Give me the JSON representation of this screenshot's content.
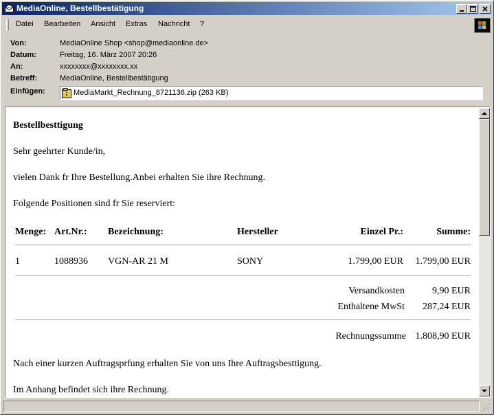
{
  "window": {
    "title": "MediaOnline, Bestellbestätigung",
    "icon": "envelope-icon"
  },
  "menu": [
    "Datei",
    "Bearbeiten",
    "Ansicht",
    "Extras",
    "Nachricht",
    "?"
  ],
  "headers": {
    "from_label": "Von:",
    "from_value": "MediaOnline Shop <shop@mediaonline.de>",
    "date_label": "Datum:",
    "date_value": "Freitag, 16. März 2007 20:26",
    "to_label": "An:",
    "to_value": "xxxxxxxx@xxxxxxxx.xx",
    "subject_label": "Betreff:",
    "subject_value": "MediaOnline, Bestellbestätigung",
    "attach_label": "Einfügen:",
    "attach_value": "MediaMarkt_Rechnung_8721136.zip (263 KB)"
  },
  "body": {
    "heading": "Bestellbesttigung",
    "greeting": "Sehr geehrter Kunde/in,",
    "intro": "vielen Dank fr Ihre Bestellung.Anbei erhalten Sie ihre Rechnung.",
    "positions_intro": "Folgende Positionen sind fr Sie reserviert:",
    "table": {
      "headers": [
        "Menge:",
        "Art.Nr.:",
        "Bezeichnung:",
        "Hersteller",
        "Einzel Pr.:",
        "Summe:"
      ],
      "rows": [
        [
          "1",
          "1088936",
          "VGN-AR 21 M",
          "SONY",
          "1.799,00 EUR",
          "1.799,00 EUR"
        ]
      ]
    },
    "shipping_label": "Versandkosten",
    "shipping_value": "9,90 EUR",
    "vat_label": "Enthaltene MwSt",
    "vat_value": "287,24 EUR",
    "total_label": "Rechnungssumme",
    "total_value": "1.808,90 EUR",
    "closing1": "Nach einer kurzen Auftragsprfung erhalten Sie von uns Ihre Auftragsbesttigung.",
    "closing2": "Im Anhang befindet sich ihre Rechnung."
  },
  "colors": {
    "titlebar_start": "#0a246a",
    "titlebar_end": "#a6caf0",
    "chrome": "#d4d0c8"
  }
}
